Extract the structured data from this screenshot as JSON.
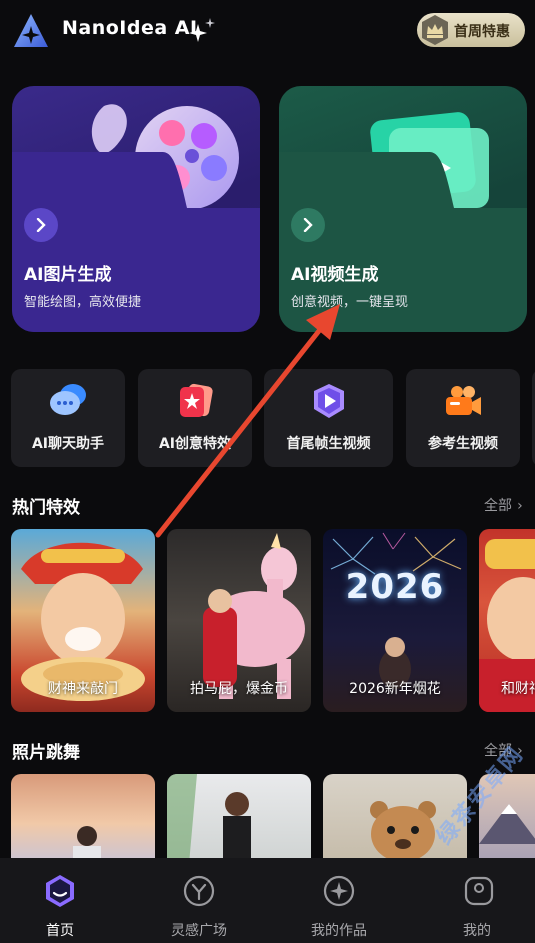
{
  "header": {
    "app_title": "NanoIdea AI",
    "promo_label": "首周特惠"
  },
  "hero_cards": [
    {
      "title": "AI图片生成",
      "subtitle": "智能绘图，高效便捷"
    },
    {
      "title": "AI视频生成",
      "subtitle": "创意视频，一键呈现"
    }
  ],
  "tools": [
    {
      "label": "AI聊天助手",
      "icon": "chat-bubble-icon"
    },
    {
      "label": "AI创意特效",
      "icon": "star-card-icon"
    },
    {
      "label": "首尾帧生视频",
      "icon": "play-shield-icon"
    },
    {
      "label": "参考生视频",
      "icon": "video-camera-icon"
    }
  ],
  "sections": {
    "hot_effects": {
      "title": "热门特效",
      "all_label": "全部"
    },
    "photo_dance": {
      "title": "照片跳舞",
      "all_label": "全部"
    }
  },
  "effects": [
    {
      "caption": "财神来敲门"
    },
    {
      "caption": "拍马屁，爆金币"
    },
    {
      "caption": "2026新年烟花",
      "image_text": "2026"
    },
    {
      "caption": "和财神"
    }
  ],
  "nav": [
    {
      "label": "首页",
      "icon": "home-icon",
      "active": true
    },
    {
      "label": "灵感广场",
      "icon": "inspiration-icon",
      "active": false
    },
    {
      "label": "我的作品",
      "icon": "works-icon",
      "active": false
    },
    {
      "label": "我的",
      "icon": "profile-icon",
      "active": false
    }
  ],
  "watermark": "绿茶安卓网",
  "colors": {
    "accent_purple": "#6b4fe0",
    "accent_green": "#2e7a62",
    "promo_gold": "#e9e2c9",
    "annotation_arrow": "#e8472f"
  }
}
